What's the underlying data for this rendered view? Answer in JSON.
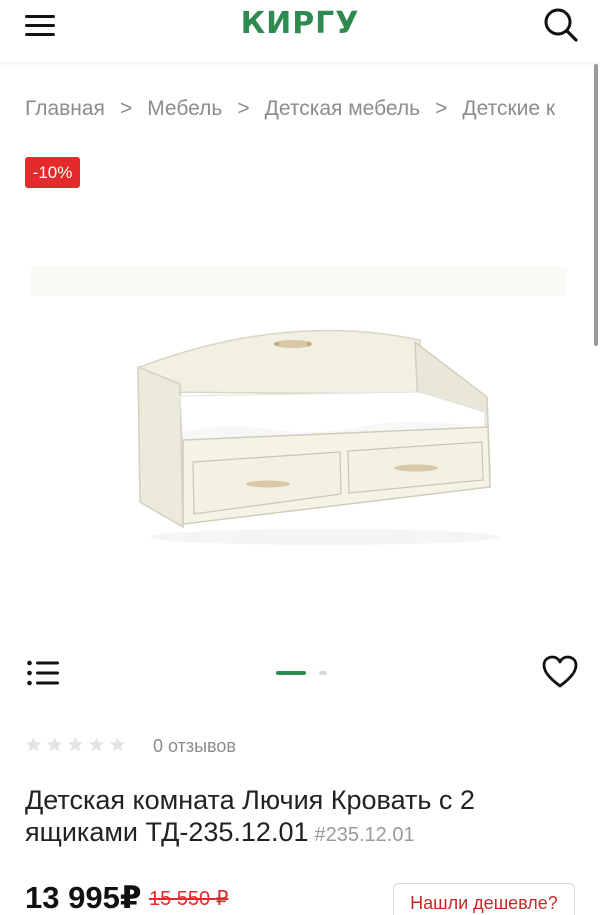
{
  "header": {
    "logo_text": "КИРГУ",
    "brand_color": "#2f8a4f",
    "menu_icon": "hamburger-icon",
    "search_icon": "search-icon"
  },
  "breadcrumb": {
    "items": [
      "Главная",
      "Мебель",
      "Детская мебель",
      "Детские к"
    ],
    "separator": ">"
  },
  "product": {
    "discount_badge": "-10%",
    "rating_stars": 0,
    "reviews_label": "0 отзывов",
    "title": "Детская комната Лючия Кровать с 2 ящиками ТД-235.12.01",
    "sku": "#235.12.01",
    "price": "13 995₽",
    "old_price": "15 550 ₽",
    "found_cheaper_label": "Нашли дешевле?",
    "accent_red": "#e32b2b"
  },
  "gallery": {
    "slide_count": 2,
    "active_slide": 1,
    "list_icon": "list-icon",
    "favorite_icon": "heart-icon"
  }
}
